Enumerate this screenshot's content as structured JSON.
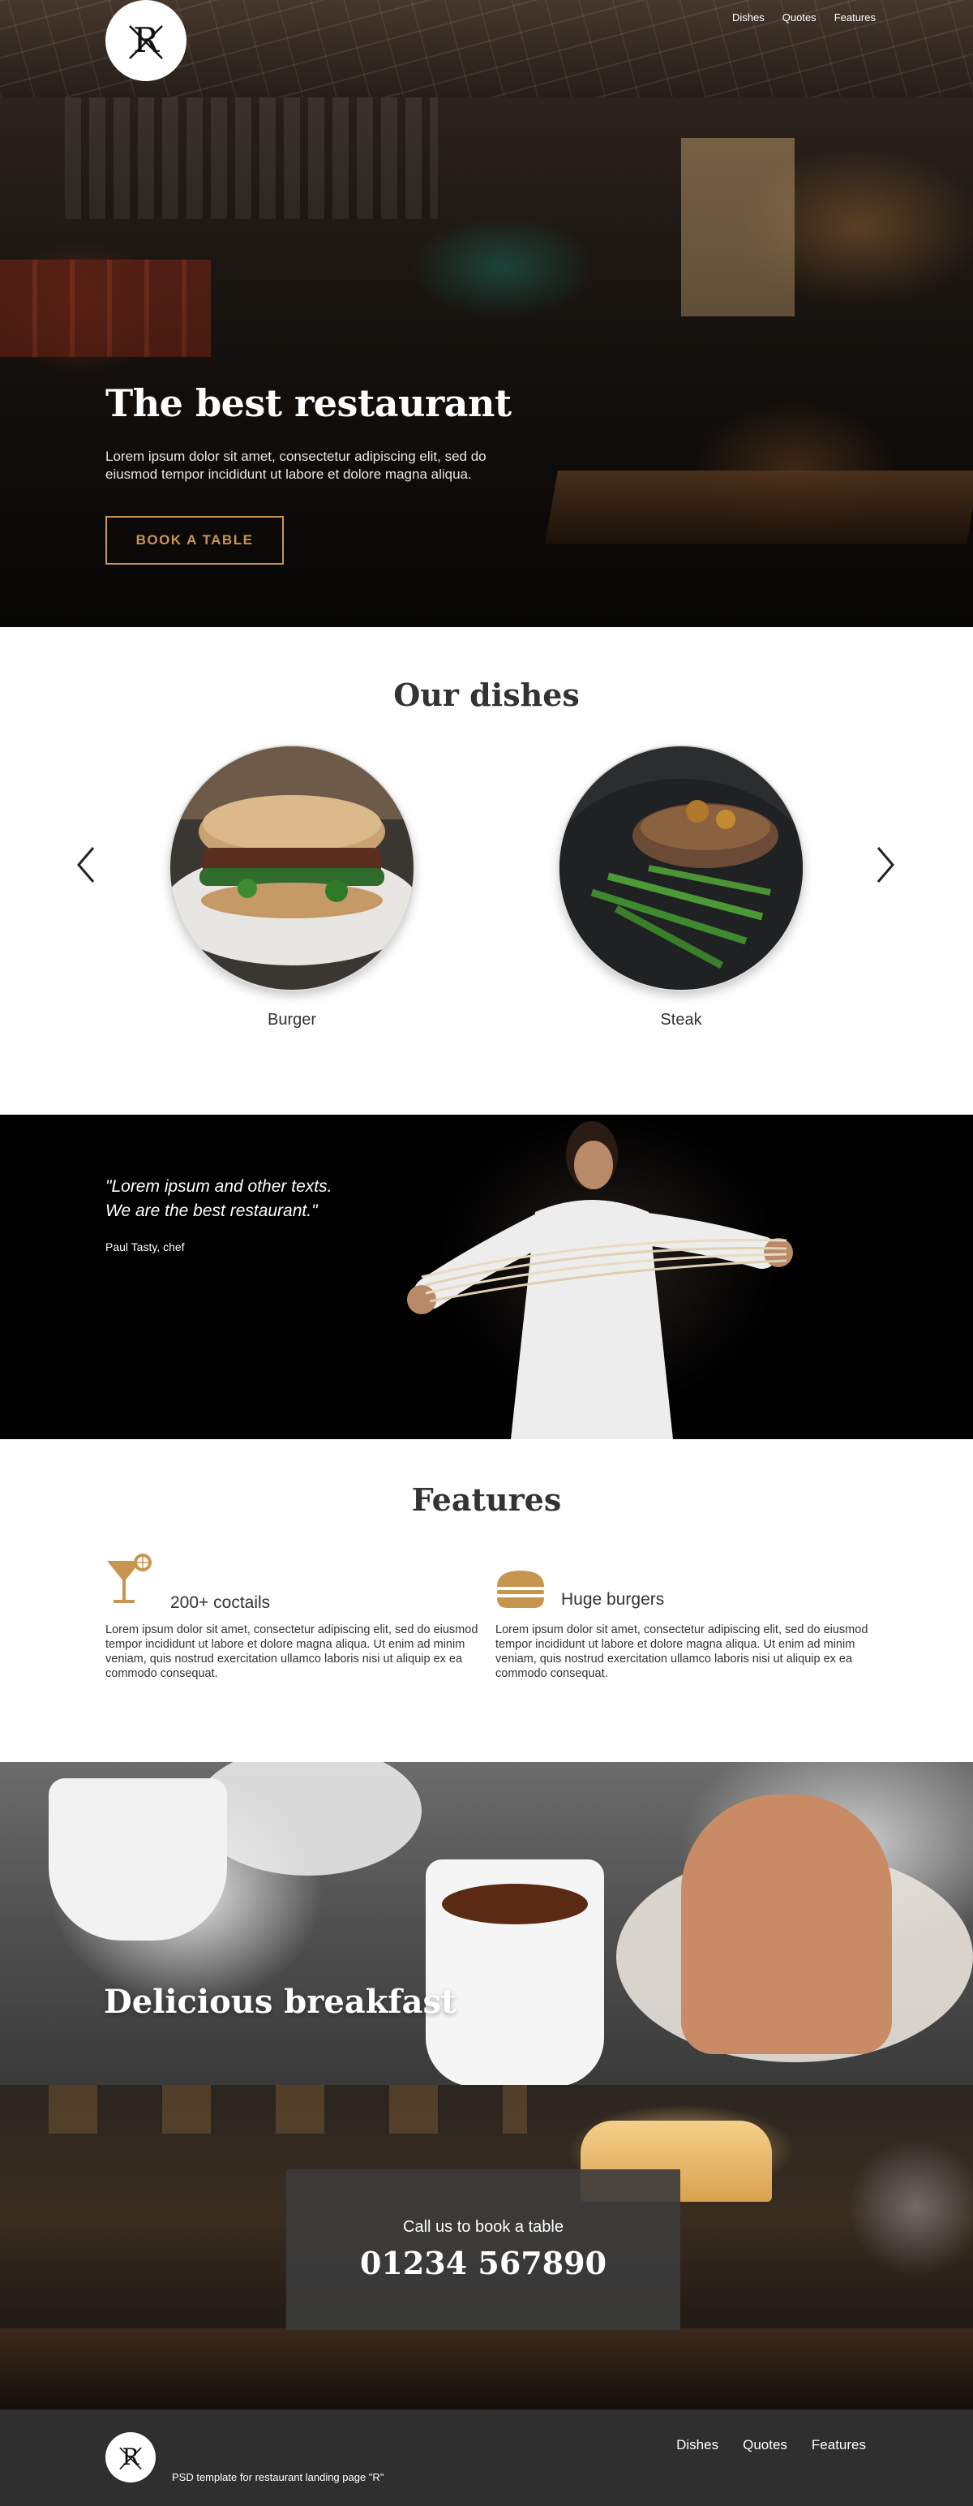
{
  "header": {
    "logo_letter": "R",
    "nav": [
      "Dishes",
      "Quotes",
      "Features"
    ]
  },
  "hero": {
    "title": "The best restaurant",
    "text": "Lorem ipsum dolor sit amet, consectetur adipiscing elit, sed do eiusmod tempor incididunt ut labore et dolore magna aliqua.",
    "button": "BOOK A TABLE"
  },
  "dishes": {
    "title": "Our dishes",
    "items": [
      {
        "name": "Burger"
      },
      {
        "name": "Steak"
      }
    ],
    "prev_icon": "chevron-left-icon",
    "next_icon": "chevron-right-icon"
  },
  "quote": {
    "line1": "\"Lorem ipsum and other texts.",
    "line2": "We are the best restaurant.\"",
    "author": "Paul Tasty, chef"
  },
  "features": {
    "title": "Features",
    "items": [
      {
        "icon": "cocktail-icon",
        "title": "200+ coctails",
        "body": "Lorem ipsum dolor sit amet, consectetur adipiscing elit, sed do eiusmod tempor incididunt ut labore et dolore magna aliqua. Ut enim ad minim veniam, quis nostrud exercitation ullamco laboris nisi ut aliquip ex ea commodo consequat."
      },
      {
        "icon": "burger-icon",
        "title": "Huge burgers",
        "body": "Lorem ipsum dolor sit amet, consectetur adipiscing elit, sed do eiusmod tempor incididunt ut labore et dolore magna aliqua. Ut enim ad minim veniam, quis nostrud exercitation ullamco laboris nisi ut aliquip ex ea commodo consequat."
      }
    ]
  },
  "breakfast": {
    "title": "Delicious breakfast"
  },
  "call": {
    "label": "Call us to book a table",
    "number": "01234 567890"
  },
  "footer": {
    "logo_letter": "R",
    "text": "PSD template for restaurant landing page \"R\"",
    "nav": [
      "Dishes",
      "Quotes",
      "Features"
    ]
  },
  "colors": {
    "accent": "#c8954f",
    "dark": "#2f2f2f",
    "text": "#333333"
  }
}
